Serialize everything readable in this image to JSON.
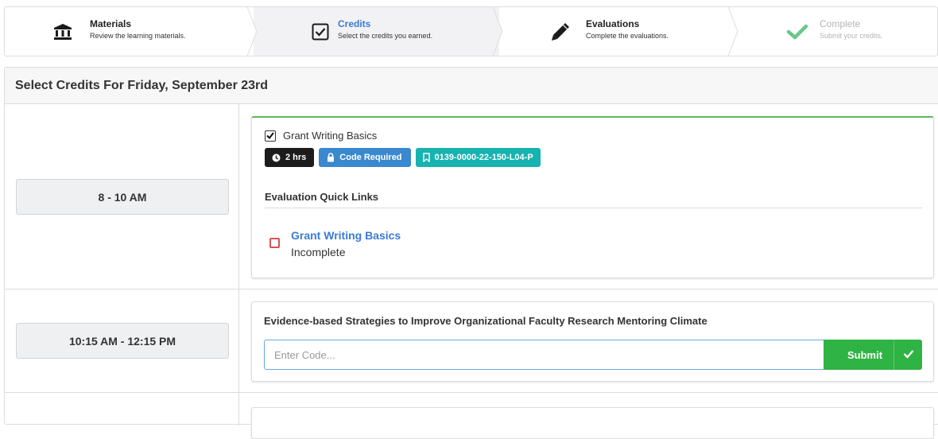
{
  "steps": [
    {
      "title": "Materials",
      "subtitle": "Review the learning materials.",
      "icon": "bank-icon",
      "state": "done"
    },
    {
      "title": "Credits",
      "subtitle": "Select the credits you earned.",
      "icon": "checkbox-icon",
      "state": "active"
    },
    {
      "title": "Evaluations",
      "subtitle": "Complete the evaluations.",
      "icon": "pencil-icon",
      "state": "todo"
    },
    {
      "title": "Complete",
      "subtitle": "Submit your credits.",
      "icon": "check-icon",
      "state": "disabled"
    }
  ],
  "panel": {
    "title": "Select Credits For Friday, September 23rd"
  },
  "sessions": [
    {
      "time": "8 - 10 AM",
      "course": "Grant Writing Basics",
      "checked": true,
      "badges": {
        "duration": "2 hrs",
        "code": "Code Required",
        "id": "0139-0000-22-150-L04-P"
      },
      "quick_links_title": "Evaluation Quick Links",
      "evaluation": {
        "title": "Grant Writing Basics",
        "status": "Incomplete"
      }
    },
    {
      "time": "10:15 AM - 12:15 PM",
      "course": "Evidence-based Strategies to Improve Organizational Faculty Research Mentoring Climate",
      "input_placeholder": "Enter Code...",
      "submit_label": "Submit"
    }
  ],
  "colors": {
    "accent_blue": "#3a7bd5",
    "success_green": "#2fb344",
    "badge_dark": "#1c1c1c",
    "badge_blue": "#3a89cf",
    "badge_teal": "#16b3b0",
    "incomplete_red": "#d9534f"
  }
}
